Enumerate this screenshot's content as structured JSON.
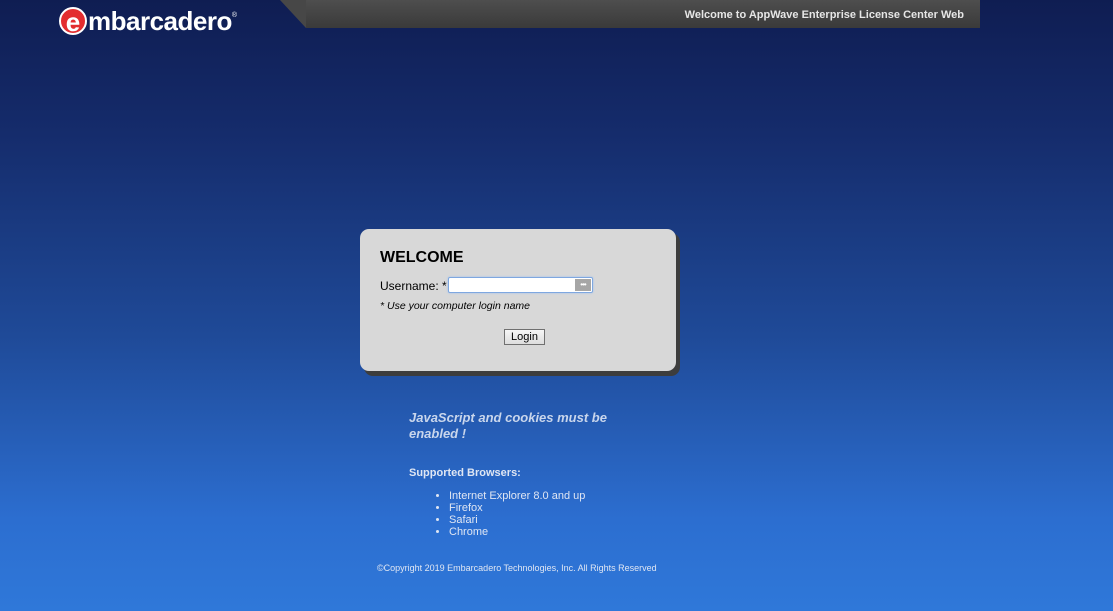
{
  "brand": {
    "logo_letter": "e",
    "logo_text": "mbarcadero",
    "logo_reg": "®"
  },
  "header": {
    "title": "Welcome to AppWave Enterprise License Center Web"
  },
  "login": {
    "heading": "WELCOME",
    "username_label": "Username: *",
    "username_value": "",
    "username_placeholder": "",
    "key_glyph": "•••",
    "hint": "* Use your computer login name",
    "login_button": "Login"
  },
  "info": {
    "js_note": "JavaScript and cookies must be enabled !",
    "browsers_title": "Supported Browsers:",
    "browsers": [
      "Internet Explorer 8.0 and up",
      "Firefox",
      "Safari",
      "Chrome"
    ]
  },
  "footer": {
    "copyright": "©Copyright 2019 Embarcadero Technologies, Inc. All Rights Reserved"
  },
  "colors": {
    "brand_red": "#e32d2f",
    "panel_bg": "#d8d8d8",
    "header_bar": "#474747"
  }
}
